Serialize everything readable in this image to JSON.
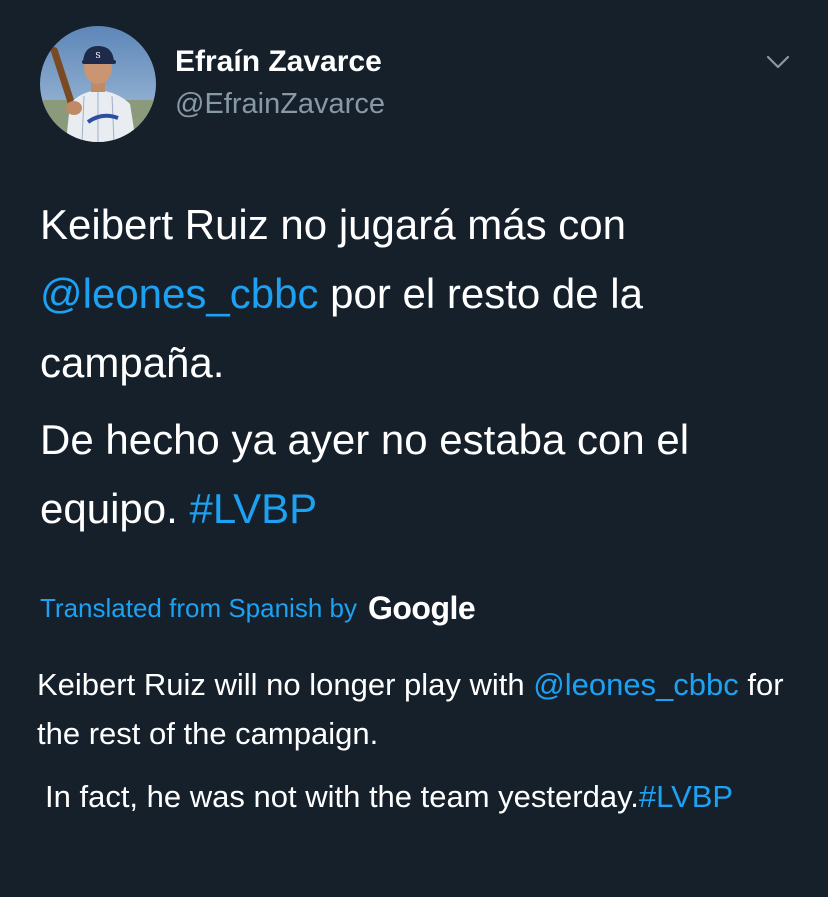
{
  "author": {
    "display_name": "Efraín Zavarce",
    "handle": "@EfrainZavarce",
    "avatar_icon": "baseball-player-avatar"
  },
  "menu_icon": "chevron-down-icon",
  "tweet": {
    "p1_text_a": "Keibert Ruiz no jugará más con ",
    "p1_mention": "@leones_cbbc",
    "p1_text_b": " por el resto de la campaña.",
    "p2_text": "De hecho ya ayer no estaba con el equipo. ",
    "p2_hashtag": "#LVBP"
  },
  "translation": {
    "label": "Translated from Spanish by",
    "provider": "Google",
    "p1_text_a": "Keibert Ruiz will no longer play with ",
    "p1_mention": "@leones_cbbc",
    "p1_text_b": " for the rest of the campaign.",
    "p2_text": "In fact, he was not with the team yesterday.",
    "p2_hashtag": "#LVBP"
  },
  "colors": {
    "background": "#15202b",
    "link": "#1da1f2",
    "secondary_text": "#8899a6",
    "primary_text": "#ffffff"
  }
}
